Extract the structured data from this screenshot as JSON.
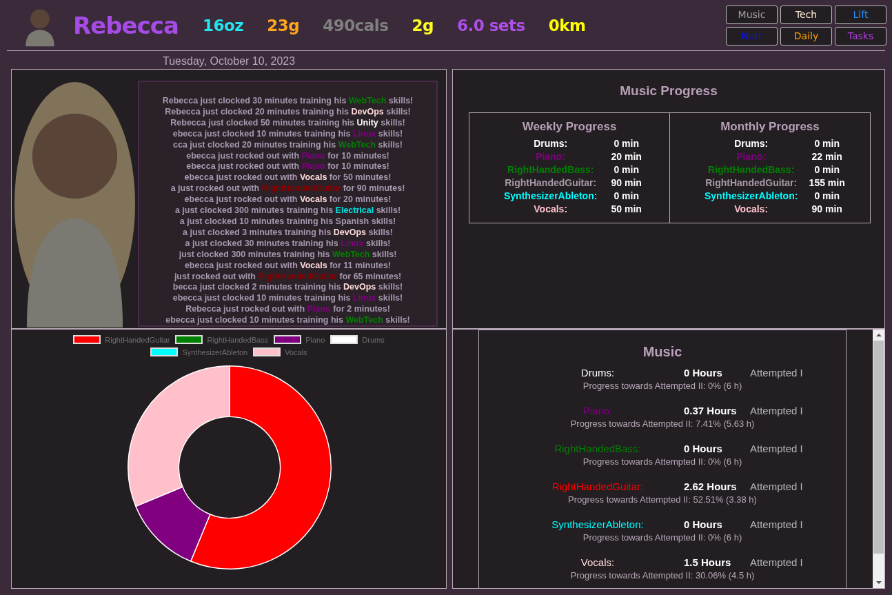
{
  "header": {
    "name": "Rebecca",
    "stats": [
      {
        "text": "16oz",
        "color": "#22e6f0"
      },
      {
        "text": "23g",
        "color": "#ffa51e"
      },
      {
        "text": "490cals",
        "color": "#808080"
      },
      {
        "text": "2g",
        "color": "#ffff22"
      },
      {
        "text": "6.0 sets",
        "color": "#b04ee8"
      },
      {
        "text": "0km",
        "color": "#ffff00"
      }
    ],
    "nav": [
      {
        "label": "Music",
        "color": "#a89aa8"
      },
      {
        "label": "Tech",
        "color": "#fff0d8"
      },
      {
        "label": "Lift",
        "color": "#1e90ff"
      },
      {
        "label": "Nutr",
        "color": "#1010ff"
      },
      {
        "label": "Daily",
        "color": "#ffa500"
      },
      {
        "label": "Tasks",
        "color": "#b040e0"
      }
    ],
    "date": "Tuesday, October 10, 2023"
  },
  "feed": [
    {
      "before": "Rebecca just clocked 30 minutes training his ",
      "skill": "WebTech",
      "color": "#008000",
      "after": " skills!"
    },
    {
      "before": "Rebecca just clocked 20 minutes training his ",
      "skill": "DevOps",
      "color": "#ffdada",
      "after": " skills!"
    },
    {
      "before": "Rebecca just clocked 50 minutes training his ",
      "skill": "Unity",
      "color": "#ffffff",
      "after": " skills!"
    },
    {
      "before": "ebecca just clocked 10 minutes training his ",
      "skill": "Linux",
      "color": "#800080",
      "after": " skills!"
    },
    {
      "before": "cca just clocked 20 minutes training his ",
      "skill": "WebTech",
      "color": "#008000",
      "after": " skills!"
    },
    {
      "before": "ebecca just rocked out with ",
      "skill": "Piano",
      "color": "#800080",
      "after": " for 10 minutes!"
    },
    {
      "before": "ebecca just rocked out with ",
      "skill": "Piano",
      "color": "#800080",
      "after": " for 10 minutes!"
    },
    {
      "before": "ebecca just rocked out with ",
      "skill": "Vocals",
      "color": "#ffdada",
      "after": " for 50 minutes!"
    },
    {
      "before": "a just rocked out with ",
      "skill": "RightHandedGuitar",
      "color": "#8b0000",
      "after": " for 90 minutes!"
    },
    {
      "before": "ebecca just rocked out with ",
      "skill": "Vocals",
      "color": "#ffdada",
      "after": " for 20 minutes!"
    },
    {
      "before": "a just clocked 300 minutes training his ",
      "skill": "Electrical",
      "color": "#00e5e5",
      "after": " skills!"
    },
    {
      "before": "a just clocked 10 minutes training his Spanish skills!"
    },
    {
      "before": "a just clocked 3 minutes training his ",
      "skill": "DevOps",
      "color": "#ffdada",
      "after": " skills!"
    },
    {
      "before": "a just clocked 30 minutes training his ",
      "skill": "Linux",
      "color": "#800080",
      "after": " skills!"
    },
    {
      "before": "just clocked 300 minutes training his ",
      "skill": "WebTech",
      "color": "#008000",
      "after": " skills!"
    },
    {
      "before": "ebecca just rocked out with ",
      "skill": "Vocals",
      "color": "#ffdada",
      "after": " for 11 minutes!"
    },
    {
      "before": "just rocked out with ",
      "skill": "RightHandedGuitar",
      "color": "#8b0000",
      "after": " for 65 minutes!"
    },
    {
      "before": "becca just clocked 2 minutes training his ",
      "skill": "DevOps",
      "color": "#ffdada",
      "after": " skills!"
    },
    {
      "before": "ebecca just clocked 10 minutes training his ",
      "skill": "Linux",
      "color": "#800080",
      "after": " skills!"
    },
    {
      "before": "Rebecca just rocked out with ",
      "skill": "Piano",
      "color": "#800080",
      "after": " for 2 minutes!"
    },
    {
      "before": "ebecca just clocked 10 minutes training his ",
      "skill": "WebTech",
      "color": "#008000",
      "after": " skills!"
    }
  ],
  "progress": {
    "title": "Music Progress",
    "tables": [
      {
        "title": "Weekly Progress",
        "rows": [
          {
            "label": "Drums:",
            "value": "0 min",
            "color": "#ffffff"
          },
          {
            "label": "Piano:",
            "value": "20 min",
            "color": "#800080"
          },
          {
            "label": "RightHandedBass:",
            "value": "0 min",
            "color": "#008000"
          },
          {
            "label": "RightHandedGuitar:",
            "value": "90 min",
            "color": "#a89aa8"
          },
          {
            "label": "SynthesizerAbleton:",
            "value": "0 min",
            "color": "#00ffff"
          },
          {
            "label": "Vocals:",
            "value": "50 min",
            "color": "#ffc0cb"
          }
        ]
      },
      {
        "title": "Monthly Progress",
        "rows": [
          {
            "label": "Drums:",
            "value": "0 min",
            "color": "#ffffff"
          },
          {
            "label": "Piano:",
            "value": "22 min",
            "color": "#800080"
          },
          {
            "label": "RightHandedBass:",
            "value": "0 min",
            "color": "#008000"
          },
          {
            "label": "RightHandedGuitar:",
            "value": "155 min",
            "color": "#a89aa8"
          },
          {
            "label": "SynthesizerAbleton:",
            "value": "0 min",
            "color": "#00ffff"
          },
          {
            "label": "Vocals:",
            "value": "90 min",
            "color": "#ffc0cb"
          }
        ]
      }
    ]
  },
  "chart_data": {
    "type": "donut",
    "categories": [
      "RightHandedGuitar",
      "RightHandedBass",
      "Piano",
      "Drums",
      "SynthesizerAbleton",
      "Vocals"
    ],
    "series": [
      {
        "values": [
          56.25,
          0,
          12.5,
          0,
          0,
          31.25
        ]
      }
    ],
    "colors": [
      "#ff0000",
      "#008000",
      "#800080",
      "#ffffff",
      "#00ffff",
      "#ffc0cb"
    ]
  },
  "music": {
    "title": "Music",
    "entries": [
      {
        "name": "Drums:",
        "color": "#ffffff",
        "hours": "0 Hours",
        "level_name": "Attempted I",
        "progress": "Progress towards Attempted II: 0% (6 h)"
      },
      {
        "name": "Piano:",
        "color": "#800080",
        "hours": "0.37 Hours",
        "level_name": "Attempted I",
        "progress": "Progress towards Attempted II: 7.41% (5.63 h)"
      },
      {
        "name": "RightHandedBass:",
        "color": "#008000",
        "hours": "0 Hours",
        "level_name": "Attempted I",
        "progress": "Progress towards Attempted II: 0% (6 h)"
      },
      {
        "name": "RightHandedGuitar:",
        "color": "#ff0000",
        "hours": "2.62 Hours",
        "level_name": "Attempted I",
        "progress": "Progress towards Attempted II: 52.51% (3.38 h)"
      },
      {
        "name": "SynthesizerAbleton:",
        "color": "#00ffff",
        "hours": "0 Hours",
        "level_name": "Attempted I",
        "progress": "Progress towards Attempted II: 0% (6 h)"
      },
      {
        "name": "Vocals:",
        "color": "#ffdada",
        "hours": "1.5 Hours",
        "level_name": "Attempted I",
        "progress": "Progress towards Attempted II: 30.06% (4.5 h)"
      }
    ]
  }
}
